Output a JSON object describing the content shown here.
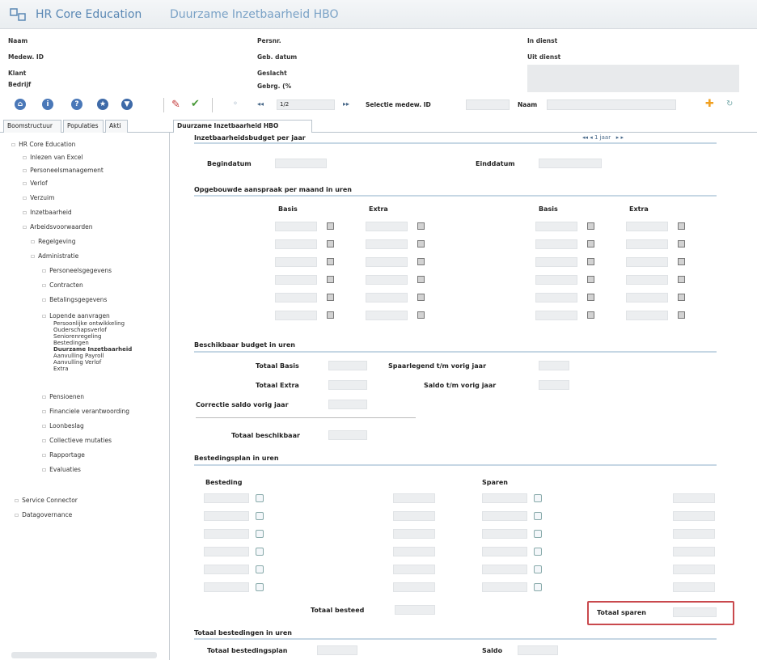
{
  "titlebar": {
    "product": "HR Core Education",
    "module": "Duurzame Inzetbaarheid HBO"
  },
  "header": {
    "left_labels": [
      "Naam",
      "Medew. ID",
      "Klant",
      "Bedrijf"
    ],
    "mid_labels": [
      "Persnr.",
      "Geb. datum",
      "Geslacht",
      "Gebrg. (%"
    ],
    "right_labels": [
      "In dienst",
      "Uit dienst"
    ]
  },
  "toolbar": {
    "nav_value": "1/2",
    "selectie_label": "Selectie medew. ID",
    "naam_label": "Naam",
    "icons": [
      "home-icon",
      "info-icon",
      "help-icon",
      "star-icon",
      "save-icon",
      "edit-icon",
      "check-icon",
      "first-icon",
      "prev-icon",
      "next-icon",
      "last-icon",
      "add-icon",
      "refresh-icon"
    ]
  },
  "tabs": [
    "Boomstructuur",
    "Populaties",
    "Akti",
    "Duurzame Inzetbaarheid HBO"
  ],
  "tree": [
    {
      "label": "HR Core Education",
      "level": 0
    },
    {
      "label": "Inlezen van Excel",
      "level": 1
    },
    {
      "label": "Personeelsmanagement",
      "level": 1
    },
    {
      "label": "Verlof",
      "level": 1
    },
    {
      "label": "Verzuim",
      "level": 1
    },
    {
      "label": "Inzetbaarheid",
      "level": 1
    },
    {
      "label": "Arbeidsvoorwaarden",
      "level": 1
    },
    {
      "label": "Regelgeving",
      "level": 2
    },
    {
      "label": "Administratie",
      "level": 2
    },
    {
      "label": "Personeelsgegevens",
      "level": 3
    },
    {
      "label": "Contracten",
      "level": 3
    },
    {
      "label": "Betalingsgegevens",
      "level": 3
    },
    {
      "label": "Lopende aanvragen",
      "level": 3
    },
    {
      "label": "Persoonlijke ontwikkeling",
      "level": 4
    },
    {
      "label": "Ouderschapsverlof",
      "level": 4
    },
    {
      "label": "Seniorenregeling",
      "level": 4
    },
    {
      "label": "Bestedingen",
      "level": 4
    },
    {
      "label": "Duurzame Inzetbaarheid",
      "level": 4
    },
    {
      "label": "Aanvulling Payroll",
      "level": 4
    },
    {
      "label": "Aanvulling Verlof",
      "level": 4
    },
    {
      "label": "Extra",
      "level": 4
    },
    {
      "label": "Pensioenen",
      "level": 3
    },
    {
      "label": "Financiele verantwoording",
      "level": 3
    },
    {
      "label": "Loonbeslag",
      "level": 3
    },
    {
      "label": "Collectieve mutaties",
      "level": 3
    },
    {
      "label": "Rapportage",
      "level": 3
    },
    {
      "label": "Evaluaties",
      "level": 3
    },
    {
      "label": "Service Connector",
      "level": 1
    },
    {
      "label": "Datagovernance",
      "level": 1
    }
  ],
  "form": {
    "section1": {
      "title": "Inzetbaarheidsbudget per jaar",
      "nav_value": "1 jaar",
      "begindatum": "Begindatum",
      "einddatum": "Einddatum"
    },
    "section2": {
      "title": "Opgebouwde aanspraak per maand in uren",
      "col_labels": [
        "Basis",
        "Extra",
        "Basis",
        "Extra"
      ],
      "rows": 6
    },
    "section3": {
      "title": "Beschikbaar budget in uren",
      "totaal_basis": "Totaal Basis",
      "totaal_extra": "Totaal Extra",
      "correctie": "Correctie saldo vorig jaar",
      "totaal_beschikbaar": "Totaal beschikbaar",
      "spaarlegend": "Spaarlegend t/m vorig jaar",
      "saldo": "Saldo t/m vorig jaar"
    },
    "section4": {
      "title": "Bestedingsplan in uren",
      "besteding": "Besteding",
      "sparen": "Sparen",
      "rows": 6,
      "totaal_besteed": "Totaal besteed",
      "totaal_sparen": "Totaal sparen"
    },
    "section5": {
      "title": "Totaal bestedingen in uren",
      "totaal_bestedingsplan": "Totaal bestedingsplan",
      "saldo": "Saldo"
    }
  }
}
